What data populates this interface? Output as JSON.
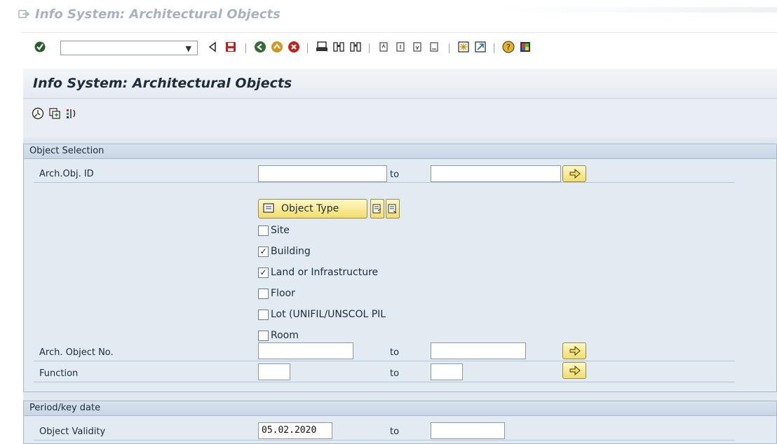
{
  "window": {
    "title": "Info System: Architectural Objects"
  },
  "toolbar": {
    "command_field_value": "",
    "icons": [
      "enter-check-icon",
      "back-triangle-icon",
      "save-icon",
      "back-icon",
      "exit-icon",
      "cancel-icon",
      "print-icon",
      "find-icon",
      "find-next-icon",
      "first-page-icon",
      "previous-page-icon",
      "next-page-icon",
      "last-page-icon",
      "create-session-icon",
      "shortcut-icon",
      "help-icon",
      "customize-icon"
    ]
  },
  "page": {
    "title": "Info System: Architectural Objects",
    "app_toolbar_icons": [
      "execute-icon",
      "get-variant-icon",
      "selection-options-icon"
    ]
  },
  "object_selection": {
    "group_title": "Object Selection",
    "arch_obj_id": {
      "label": "Arch.Obj. ID",
      "from": "",
      "to_label": "to",
      "to": ""
    },
    "object_type_button": "Object Type",
    "checkboxes": [
      {
        "label": "Site",
        "checked": false
      },
      {
        "label": "Building",
        "checked": true
      },
      {
        "label": "Land or Infrastructure",
        "checked": true
      },
      {
        "label": "Floor",
        "checked": false
      },
      {
        "label": "Lot (UNIFIL/UNSCOL PIL",
        "checked": false
      },
      {
        "label": "Room",
        "checked": false
      }
    ],
    "arch_object_no": {
      "label": "Arch. Object No.",
      "from": "",
      "to_label": "to",
      "to": ""
    },
    "function": {
      "label": "Function",
      "from": "",
      "to_label": "to",
      "to": ""
    }
  },
  "period": {
    "group_title": "Period/key date",
    "object_validity": {
      "label": "Object Validity",
      "from": "05.02.2020",
      "to_label": "to",
      "to": ""
    }
  },
  "colors": {
    "button_yellow": "#f3dd6a",
    "panel_blue": "#dfe8f1",
    "header_text": "#1f2d3a"
  }
}
